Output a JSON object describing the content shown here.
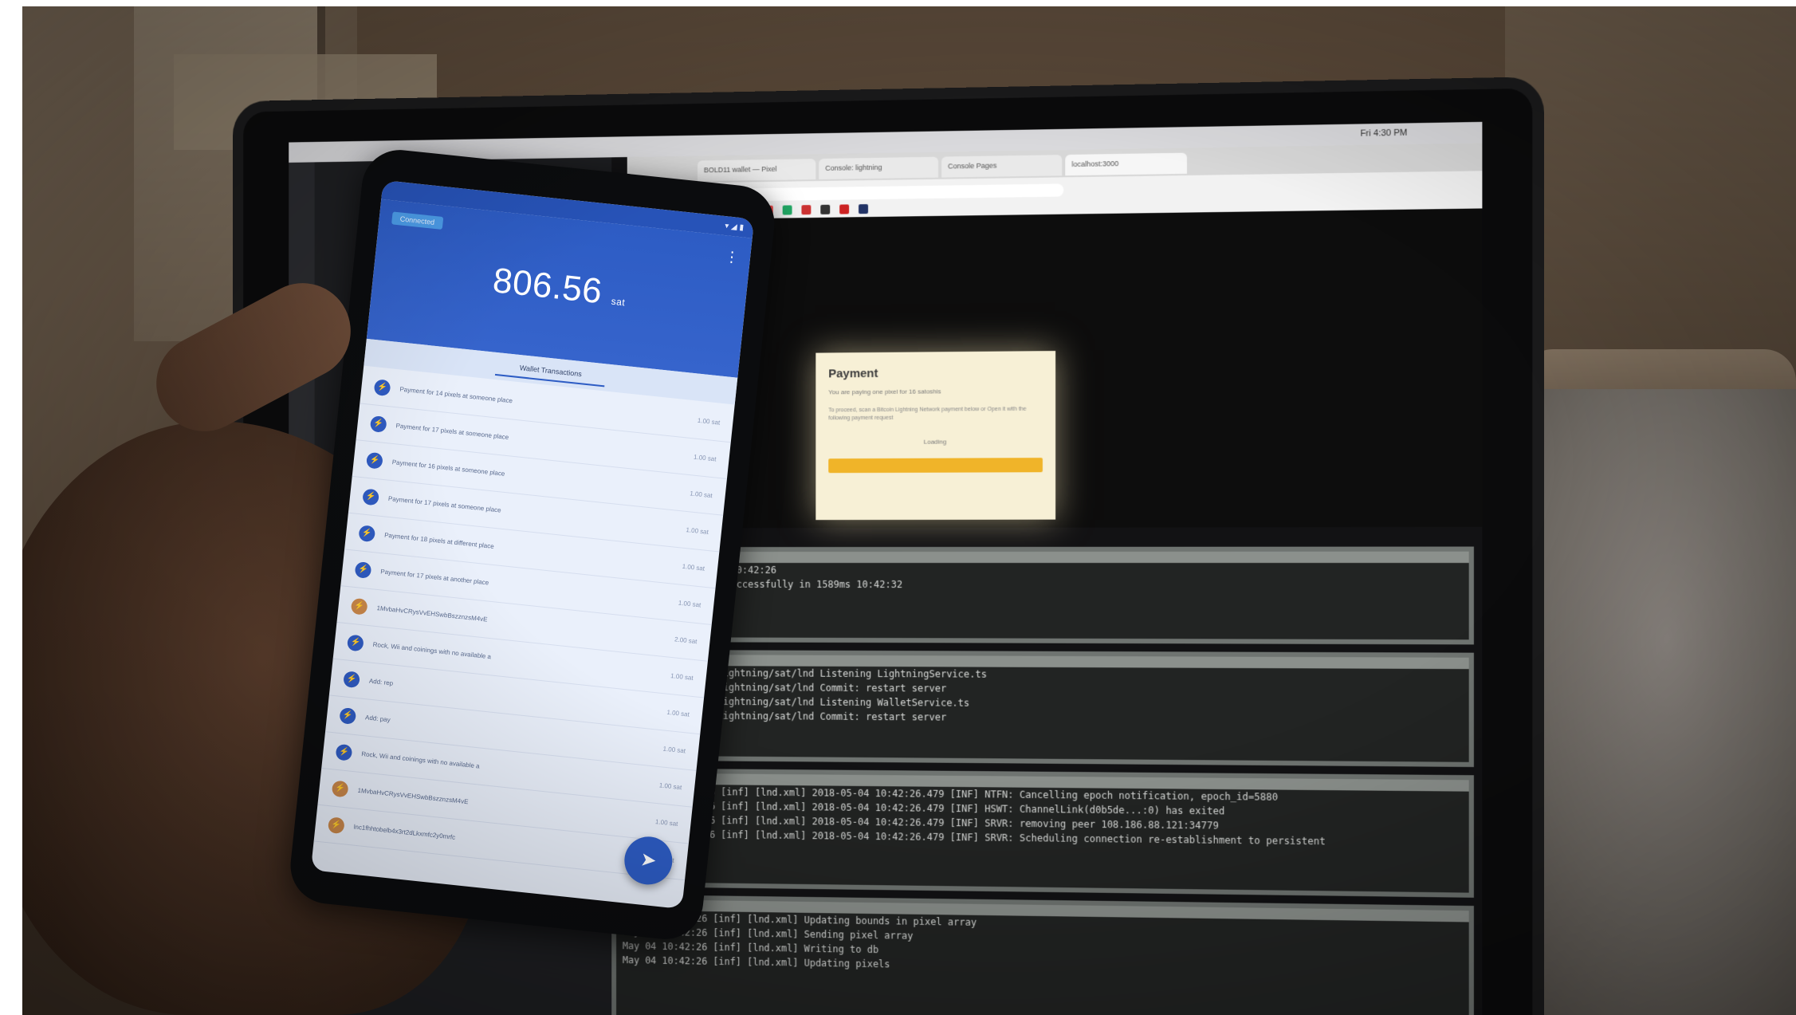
{
  "phone": {
    "balance": "806.56",
    "balance_unit": "sat",
    "chip": "Connected",
    "tab": "Wallet Transactions",
    "fab_icon": "send-icon",
    "transactions": [
      {
        "label": "Payment for 14 pixels at someone place",
        "amount": "1.00 sat"
      },
      {
        "label": "Payment for 17 pixels at someone place",
        "amount": "1.00 sat"
      },
      {
        "label": "Payment for 16 pixels at someone place",
        "amount": "1.00 sat"
      },
      {
        "label": "Payment for 17 pixels at someone place",
        "amount": "1.00 sat"
      },
      {
        "label": "Payment for 18 pixels at different place",
        "amount": "1.00 sat"
      },
      {
        "label": "Payment for 17 pixels at another place",
        "amount": "1.00 sat"
      },
      {
        "label": "1MvbaHvCRysVvEHSwbBszznzsM4vE",
        "amount": "2.00 sat",
        "pending": true
      },
      {
        "label": "Rock, Wii and coinings with no available a",
        "amount": "1.00 sat"
      },
      {
        "label": "Add: rep",
        "amount": "1.00 sat"
      },
      {
        "label": "Add: pay",
        "amount": "1.00 sat"
      },
      {
        "label": "Rock, Wii and coinings with no available a",
        "amount": "1.00 sat"
      },
      {
        "label": "1MvbaHvCRysVvEHSwbBszznzsM4vE",
        "amount": "1.00 sat",
        "pending": true
      },
      {
        "label": "lnc1fhhtobelb4x3rt2dLkxmfc2y0mrfc",
        "amount": "1.00 sat",
        "pending": true
      }
    ]
  },
  "browser": {
    "tabs": [
      "BOLD11 wallet — Pixel",
      "Console: lightning",
      "Console Pages",
      "localhost:3000"
    ],
    "url": "localhost:3000"
  },
  "dialog": {
    "title": "Payment",
    "subtitle": "You are paying one pixel for 16 satoshis",
    "description": "To proceed, scan a Bitcoin Lightning Network payment below or Open it with the following payment request",
    "loading": "Loading"
  },
  "terminals": [
    {
      "lines": [
        "WAIT   Compiling   10:42:26",
        "DONE   Compiled successfully in 1589ms   10:42:32"
      ]
    },
    {
      "lines": [
        "lnd-start-1 | lightning/sat/lnd   Listening LightningService.ts",
        "lnd-start-1 | lightning/sat/lnd   Commit: restart server",
        "lnd-start-1 | lightning/sat/lnd   Listening WalletService.ts",
        "lnd-start-1 | lightning/sat/lnd   Commit: restart server"
      ]
    },
    {
      "lines": [
        "May 04 10:42:26 [inf] [lnd.xml] 2018-05-04 10:42:26.479 [INF] NTFN: Cancelling epoch notification, epoch_id=5880",
        "May 04 10:42:26 [inf] [lnd.xml] 2018-05-04 10:42:26.479 [INF] HSWT: ChannelLink(d0b5de...:0) has exited",
        "May 04 10:42:26 [inf] [lnd.xml] 2018-05-04 10:42:26.479 [INF] SRVR: removing peer 108.186.88.121:34779",
        "May 04 10:42:26 [inf] [lnd.xml] 2018-05-04 10:42:26.479 [INF] SRVR: Scheduling connection re-establishment to persistent"
      ]
    },
    {
      "lines": [
        "May 04 10:42:26 [inf] [lnd.xml] Updating bounds in pixel array",
        "May 04 10:42:26 [inf] [lnd.xml] Sending pixel array",
        "May 04 10:42:26 [inf] [lnd.xml] Writing to db",
        "May 04 10:42:26 [inf] [lnd.xml] Updating pixels"
      ]
    }
  ],
  "menubar_clock": "Fri 4:30 PM",
  "colors": {
    "wallet_blue": "#2d5cc4",
    "dialog_button": "#f0b429"
  }
}
